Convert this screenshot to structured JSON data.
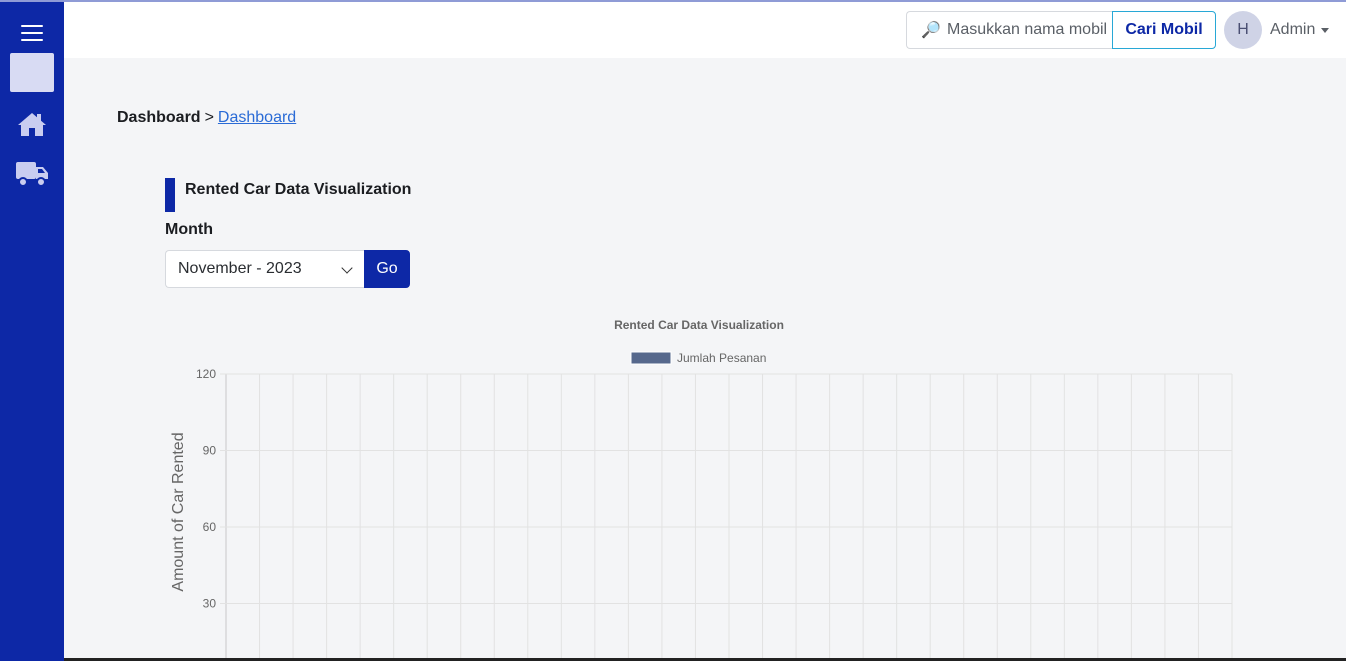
{
  "navbar": {
    "search_placeholder": "Masukkan nama mobil",
    "search_button": "Cari Mobil",
    "avatar_initial": "H",
    "user_name": "Admin"
  },
  "sidebar": {
    "icons": [
      "menu-icon",
      "logo",
      "home-icon",
      "truck-icon"
    ]
  },
  "breadcrumb": {
    "root": "Dashboard",
    "separator": ">",
    "current": "Dashboard"
  },
  "section": {
    "title": "Rented Car Data Visualization",
    "month_label": "Month",
    "month_value": "November - 2023",
    "go_label": "Go"
  },
  "chart_data": {
    "type": "bar",
    "title": "Rented Car Data Visualization",
    "ylabel": "Amount of Car Rented",
    "xlabel": "",
    "ylim": [
      0,
      120
    ],
    "yticks": [
      120,
      90,
      60,
      30
    ],
    "grid": true,
    "legend_position": "top-center",
    "series": [
      {
        "name": "Jumlah Pesanan",
        "color": "#56688c",
        "values": []
      }
    ]
  },
  "colors": {
    "primary": "#0d28a6",
    "accent": "#28a8d6",
    "link": "#2a6bd6"
  }
}
